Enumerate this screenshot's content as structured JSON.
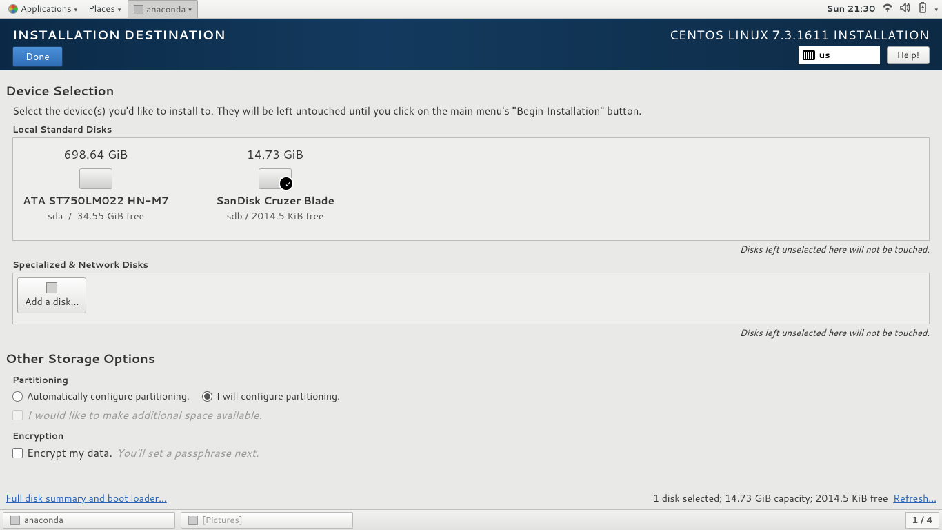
{
  "topbar": {
    "apps": "Applications",
    "places": "Places",
    "current_app": "anaconda",
    "clock": "Sun 21:30"
  },
  "header": {
    "title": "INSTALLATION DESTINATION",
    "done": "Done",
    "product": "CENTOS LINUX 7.3.1611 INSTALLATION",
    "kb_layout": "us",
    "help": "Help!"
  },
  "device_selection": {
    "heading": "Device Selection",
    "hint": "Select the device(s) you'd like to install to.  They will be left untouched until you click on the main menu's \"Begin Installation\" button.",
    "local_label": "Local Standard Disks",
    "disks": [
      {
        "size": "698.64 GiB",
        "name": "ATA ST750LM022 HN-M7",
        "dev": "sda",
        "free": "34.55 GiB free",
        "selected": false
      },
      {
        "size": "14.73 GiB",
        "name": "SanDisk Cruzer Blade",
        "dev": "sdb",
        "free": "2014.5 KiB free",
        "selected": true
      }
    ],
    "unselected_note": "Disks left unselected here will not be touched.",
    "network_label": "Specialized & Network Disks",
    "add_disk": "Add a disk..."
  },
  "storage_options": {
    "heading": "Other Storage Options",
    "partitioning_label": "Partitioning",
    "auto_label": "Automatically configure partitioning.",
    "manual_label": "I will configure partitioning.",
    "manual_selected": true,
    "additional_space": "I would like to make additional space available.",
    "encryption_label": "Encryption",
    "encrypt_label": "Encrypt my data.",
    "encrypt_hint": "You'll set a passphrase next."
  },
  "footer": {
    "summary_link": "Full disk summary and boot loader...",
    "status": "1 disk selected; 14.73 GiB capacity; 2014.5 KiB free",
    "refresh": "Refresh..."
  },
  "taskbar": {
    "items": [
      {
        "label": "anaconda",
        "active": true
      },
      {
        "label": "[Pictures]",
        "active": false
      }
    ],
    "workspace": "1 / 4"
  }
}
